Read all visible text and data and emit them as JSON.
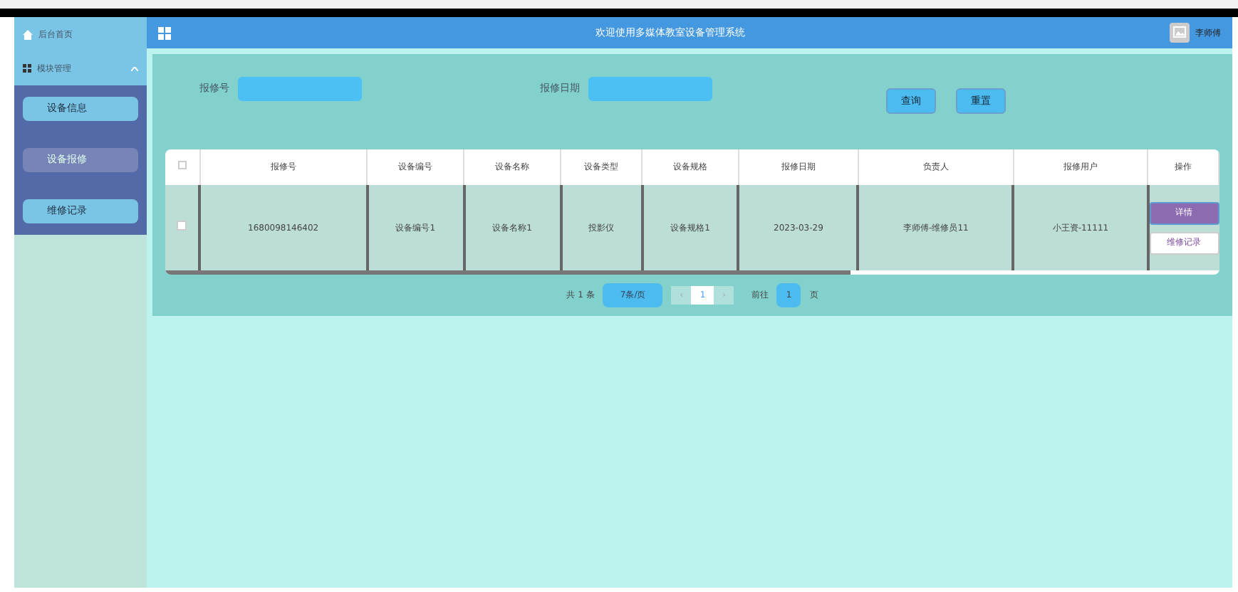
{
  "sidebar": {
    "items": [
      {
        "kind": "link",
        "label": "后台首页"
      },
      {
        "kind": "group",
        "label": "模块管理",
        "expanded": true
      }
    ],
    "subitems": [
      {
        "label": "设备信息",
        "selected": false
      },
      {
        "label": "设备报修",
        "selected": true
      },
      {
        "label": "维修记录",
        "selected": false
      }
    ]
  },
  "header": {
    "title": "欢迎使用多媒体教室设备管理系统",
    "user": "李师傅"
  },
  "search": {
    "fields": [
      {
        "label": "报修号"
      },
      {
        "label": "报修日期"
      }
    ],
    "buttons": [
      "查询",
      "重置"
    ]
  },
  "table": {
    "select_all_checked": false,
    "columns": [
      "报修号",
      "设备编号",
      "设备名称",
      "设备类型",
      "设备规格",
      "报修日期",
      "负责人",
      "报修用户",
      "操作"
    ],
    "rows": [
      {
        "checked": false,
        "cells": [
          "1680098146402",
          "设备编号1",
          "设备名称1",
          "投影仪",
          "设备规格1",
          "2023-03-29",
          "李师傅-维修员11",
          "小王资-11111"
        ],
        "actions": [
          "详情",
          "维修记录"
        ]
      }
    ]
  },
  "pagination": {
    "total": "共 1 条",
    "page_size": "7条/页",
    "prev": "‹",
    "page": "1",
    "next": "›",
    "goto": "前往",
    "goto_value": "1",
    "page_suffix": "页"
  }
}
